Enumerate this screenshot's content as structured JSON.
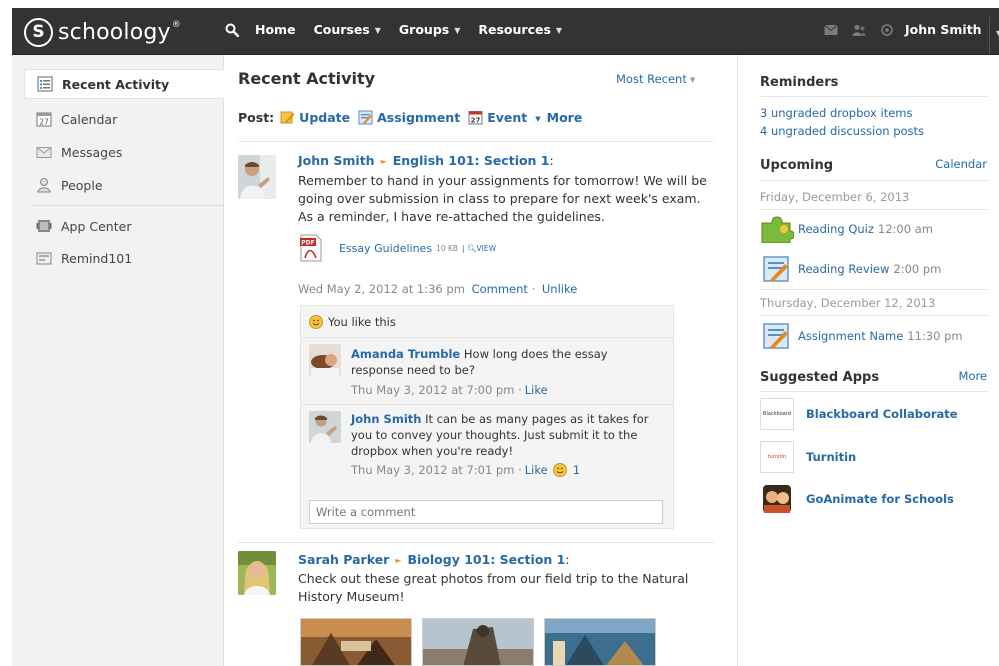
{
  "topbar": {
    "logo_mark": "S",
    "logo_text": "schoology",
    "logo_reg": "®",
    "nav": [
      "Home",
      "Courses",
      "Groups",
      "Resources"
    ],
    "user_name": "John Smith"
  },
  "sidebar": {
    "items": [
      {
        "label": "Recent Activity",
        "icon": "recent-activity-icon"
      },
      {
        "label": "Calendar",
        "icon": "calendar-icon",
        "icon_text": "27"
      },
      {
        "label": "Messages",
        "icon": "envelope-icon"
      },
      {
        "label": "People",
        "icon": "person-icon"
      },
      {
        "label": "App Center",
        "icon": "app-center-icon"
      },
      {
        "label": "Remind101",
        "icon": "remind101-icon"
      }
    ]
  },
  "main": {
    "title": "Recent Activity",
    "sort_label": "Most Recent",
    "post": {
      "label": "Post:",
      "update": "Update",
      "assignment": "Assignment",
      "event": "Event",
      "event_icon_text": "27",
      "more": "More"
    },
    "feed": [
      {
        "author": "John Smith",
        "course": "English 101: Section 1",
        "colon": ":",
        "text": "Remember to hand in your assignments for tomorrow! We will be going over submission in class to prepare for next week's exam. As a reminder, I have re-attached the guidelines.",
        "attachment": {
          "name": "Essay Guidelines",
          "size": "10 KB",
          "view": "VIEW",
          "icon_text": "PDF"
        },
        "date": "Wed May 2, 2012 at 1:36 pm",
        "comment_label": "Comment",
        "unlike_label": "Unlike",
        "likes_text": "You like this",
        "comments": [
          {
            "author": "Amanda Trumble",
            "text": " How long does the essay response need to be?",
            "date": "Thu May 3, 2012 at 7:00 pm",
            "like": "Like"
          },
          {
            "author": "John Smith",
            "text": " It can be as many pages as it takes for you to convey your thoughts. Just submit it to the dropbox when you're ready!",
            "date": "Thu May 3, 2012 at 7:01 pm",
            "like": "Like",
            "like_count": "1"
          }
        ],
        "write_placeholder": "Write a comment"
      },
      {
        "author": "Sarah Parker",
        "course": "Biology 101: Section 1",
        "colon": ":",
        "text": "Check out these great photos from our field trip to the Natural History Museum!"
      }
    ]
  },
  "right": {
    "reminders": {
      "title": "Reminders",
      "items": [
        "3 ungraded dropbox items",
        "4 ungraded discussion posts"
      ]
    },
    "upcoming": {
      "title": "Upcoming",
      "calendar_link": "Calendar",
      "groups": [
        {
          "date": "Friday, December 6, 2013",
          "events": [
            {
              "name": "Reading Quiz",
              "time": "12:00 am",
              "icon": "puzzle-icon"
            },
            {
              "name": "Reading Review",
              "time": "2:00 pm",
              "icon": "assignment-icon"
            }
          ]
        },
        {
          "date": "Thursday, December 12, 2013",
          "events": [
            {
              "name": "Assignment Name",
              "time": "11:30 pm",
              "icon": "assignment-icon"
            }
          ]
        }
      ]
    },
    "apps": {
      "title": "Suggested Apps",
      "more": "More",
      "items": [
        {
          "name": "Blackboard Collaborate",
          "logo_text": "Blackboard"
        },
        {
          "name": "Turnitin",
          "logo_text": "turnitin"
        },
        {
          "name": "GoAnimate for Schools"
        }
      ]
    }
  }
}
